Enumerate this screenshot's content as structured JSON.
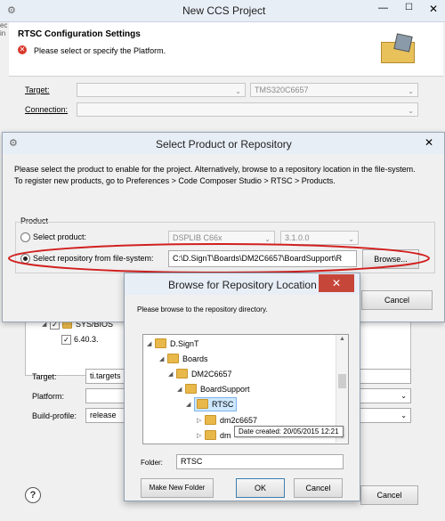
{
  "main_window": {
    "title": "New CCS Project",
    "left_edge_labels": [
      "ec",
      "in"
    ],
    "header_title": "RTSC Configuration Settings",
    "error_text": "Please select or specify the Platform.",
    "target_label": "Target:",
    "target_value": "TMS320C6657",
    "connection_label": "Connection:",
    "tree_sysbios": "SYS/BIOS",
    "tree_version": "6.40.3.",
    "rtsc_target_label": "Target:",
    "rtsc_target_value": "ti.targets",
    "platform_label": "Platform:",
    "build_profile_label": "Build-profile:",
    "build_profile_value": "release",
    "help_icon_glyph": "?",
    "cancel_label": "Cancel"
  },
  "product_dialog": {
    "title": "Select Product or Repository",
    "description": "Please select the product to enable for the project. Alternatively, browse to a repository location in the file-system. To register new products, go to Preferences > Code Composer Studio > RTSC > Products.",
    "group_label": "Product",
    "select_product_label": "Select product:",
    "product_value": "DSPLIB C66x",
    "version_value": "3.1.0.0",
    "select_repo_label": "Select repository from file-system:",
    "repo_path": "C:\\D.SignT\\Boards\\DM2C6657\\BoardSupport\\R",
    "browse_label": "Browse...",
    "cancel_label": "Cancel"
  },
  "browse_dialog": {
    "title": "Browse for Repository Location",
    "close_glyph": "✕",
    "instruction": "Please browse to the repository directory.",
    "tree": [
      {
        "label": "D.SignT",
        "level": 0,
        "expander": "◢"
      },
      {
        "label": "Boards",
        "level": 1,
        "expander": "◢"
      },
      {
        "label": "DM2C6657",
        "level": 2,
        "expander": "◢"
      },
      {
        "label": "BoardSupport",
        "level": 3,
        "expander": "◢"
      },
      {
        "label": "RTSC",
        "level": 4,
        "expander": "◢",
        "selected": true
      },
      {
        "label": "dm2c6657",
        "level": 5,
        "expander": "▷"
      },
      {
        "label": "dm",
        "level": 5,
        "expander": "▷"
      }
    ],
    "tooltip": "Date created: 20/05/2015 12:21",
    "folder_label": "Folder:",
    "folder_value": "RTSC",
    "make_new_folder_label": "Make New Folder",
    "ok_label": "OK",
    "cancel_label": "Cancel"
  },
  "colors": {
    "error_red": "#d9382b",
    "highlight_ellipse": "#d1201f",
    "selection_blue": "#cde8ff",
    "close_red": "#c7463a"
  }
}
